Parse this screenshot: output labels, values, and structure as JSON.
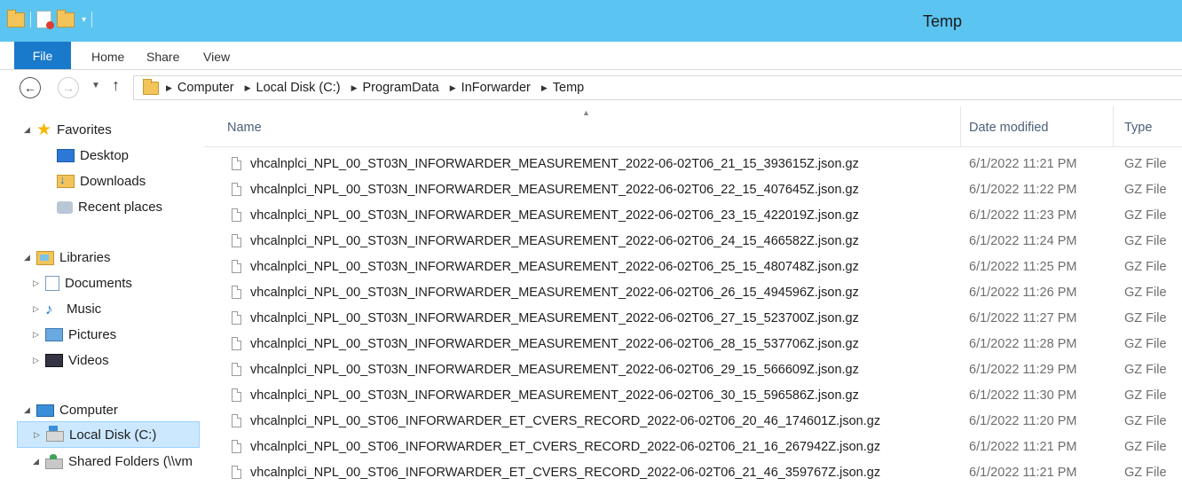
{
  "window": {
    "title": "Temp"
  },
  "ribbon": {
    "tabs": [
      "File",
      "Home",
      "Share",
      "View"
    ]
  },
  "address": {
    "crumbs": [
      "Computer",
      "Local Disk (C:)",
      "ProgramData",
      "InForwarder",
      "Temp"
    ]
  },
  "nav_pane": {
    "favorites": {
      "label": "Favorites",
      "items": [
        "Desktop",
        "Downloads",
        "Recent places"
      ]
    },
    "libraries": {
      "label": "Libraries",
      "items": [
        "Documents",
        "Music",
        "Pictures",
        "Videos"
      ]
    },
    "computer": {
      "label": "Computer",
      "items": [
        "Local Disk (C:)",
        "Shared Folders (\\\\vm"
      ]
    },
    "selected": "Local Disk (C:)"
  },
  "columns": {
    "name": "Name",
    "date": "Date modified",
    "type": "Type"
  },
  "files": [
    {
      "name": "vhcalnplci_NPL_00_ST03N_INFORWARDER_MEASUREMENT_2022-06-02T06_21_15_393615Z.json.gz",
      "date": "6/1/2022 11:21 PM",
      "type": "GZ File"
    },
    {
      "name": "vhcalnplci_NPL_00_ST03N_INFORWARDER_MEASUREMENT_2022-06-02T06_22_15_407645Z.json.gz",
      "date": "6/1/2022 11:22 PM",
      "type": "GZ File"
    },
    {
      "name": "vhcalnplci_NPL_00_ST03N_INFORWARDER_MEASUREMENT_2022-06-02T06_23_15_422019Z.json.gz",
      "date": "6/1/2022 11:23 PM",
      "type": "GZ File"
    },
    {
      "name": "vhcalnplci_NPL_00_ST03N_INFORWARDER_MEASUREMENT_2022-06-02T06_24_15_466582Z.json.gz",
      "date": "6/1/2022 11:24 PM",
      "type": "GZ File"
    },
    {
      "name": "vhcalnplci_NPL_00_ST03N_INFORWARDER_MEASUREMENT_2022-06-02T06_25_15_480748Z.json.gz",
      "date": "6/1/2022 11:25 PM",
      "type": "GZ File"
    },
    {
      "name": "vhcalnplci_NPL_00_ST03N_INFORWARDER_MEASUREMENT_2022-06-02T06_26_15_494596Z.json.gz",
      "date": "6/1/2022 11:26 PM",
      "type": "GZ File"
    },
    {
      "name": "vhcalnplci_NPL_00_ST03N_INFORWARDER_MEASUREMENT_2022-06-02T06_27_15_523700Z.json.gz",
      "date": "6/1/2022 11:27 PM",
      "type": "GZ File"
    },
    {
      "name": "vhcalnplci_NPL_00_ST03N_INFORWARDER_MEASUREMENT_2022-06-02T06_28_15_537706Z.json.gz",
      "date": "6/1/2022 11:28 PM",
      "type": "GZ File"
    },
    {
      "name": "vhcalnplci_NPL_00_ST03N_INFORWARDER_MEASUREMENT_2022-06-02T06_29_15_566609Z.json.gz",
      "date": "6/1/2022 11:29 PM",
      "type": "GZ File"
    },
    {
      "name": "vhcalnplci_NPL_00_ST03N_INFORWARDER_MEASUREMENT_2022-06-02T06_30_15_596586Z.json.gz",
      "date": "6/1/2022 11:30 PM",
      "type": "GZ File"
    },
    {
      "name": "vhcalnplci_NPL_00_ST06_INFORWARDER_ET_CVERS_RECORD_2022-06-02T06_20_46_174601Z.json.gz",
      "date": "6/1/2022 11:20 PM",
      "type": "GZ File"
    },
    {
      "name": "vhcalnplci_NPL_00_ST06_INFORWARDER_ET_CVERS_RECORD_2022-06-02T06_21_16_267942Z.json.gz",
      "date": "6/1/2022 11:21 PM",
      "type": "GZ File"
    },
    {
      "name": "vhcalnplci_NPL_00_ST06_INFORWARDER_ET_CVERS_RECORD_2022-06-02T06_21_46_359767Z.json.gz",
      "date": "6/1/2022 11:21 PM",
      "type": "GZ File"
    }
  ]
}
